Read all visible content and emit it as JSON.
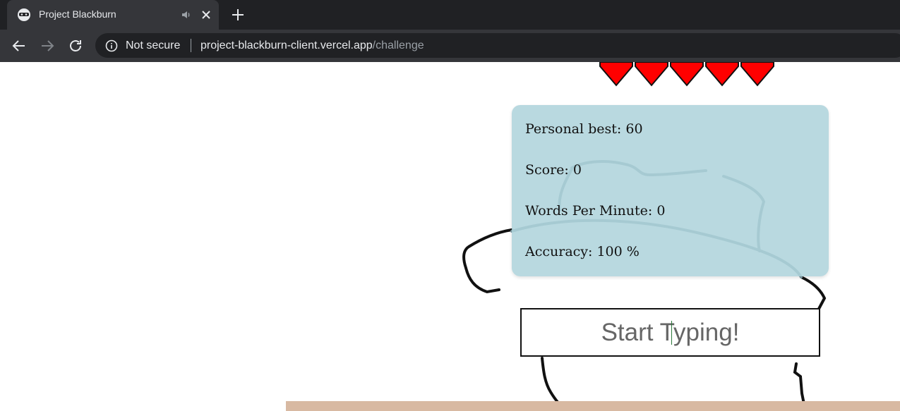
{
  "browser": {
    "tab": {
      "title": "Project Blackburn"
    },
    "omnibox": {
      "security_label": "Not secure",
      "url_host": "project-blackburn-client.vercel.app",
      "url_path": "/challenge"
    }
  },
  "game": {
    "lives": 5,
    "heart_color": "#ff0000",
    "stats": {
      "personal_best": "Personal best: 60",
      "score": "Score: 0",
      "wpm": "Words Per Minute: 0",
      "accuracy": "Accuracy: 100 %"
    },
    "input": {
      "placeholder": "Start Typing!"
    }
  }
}
